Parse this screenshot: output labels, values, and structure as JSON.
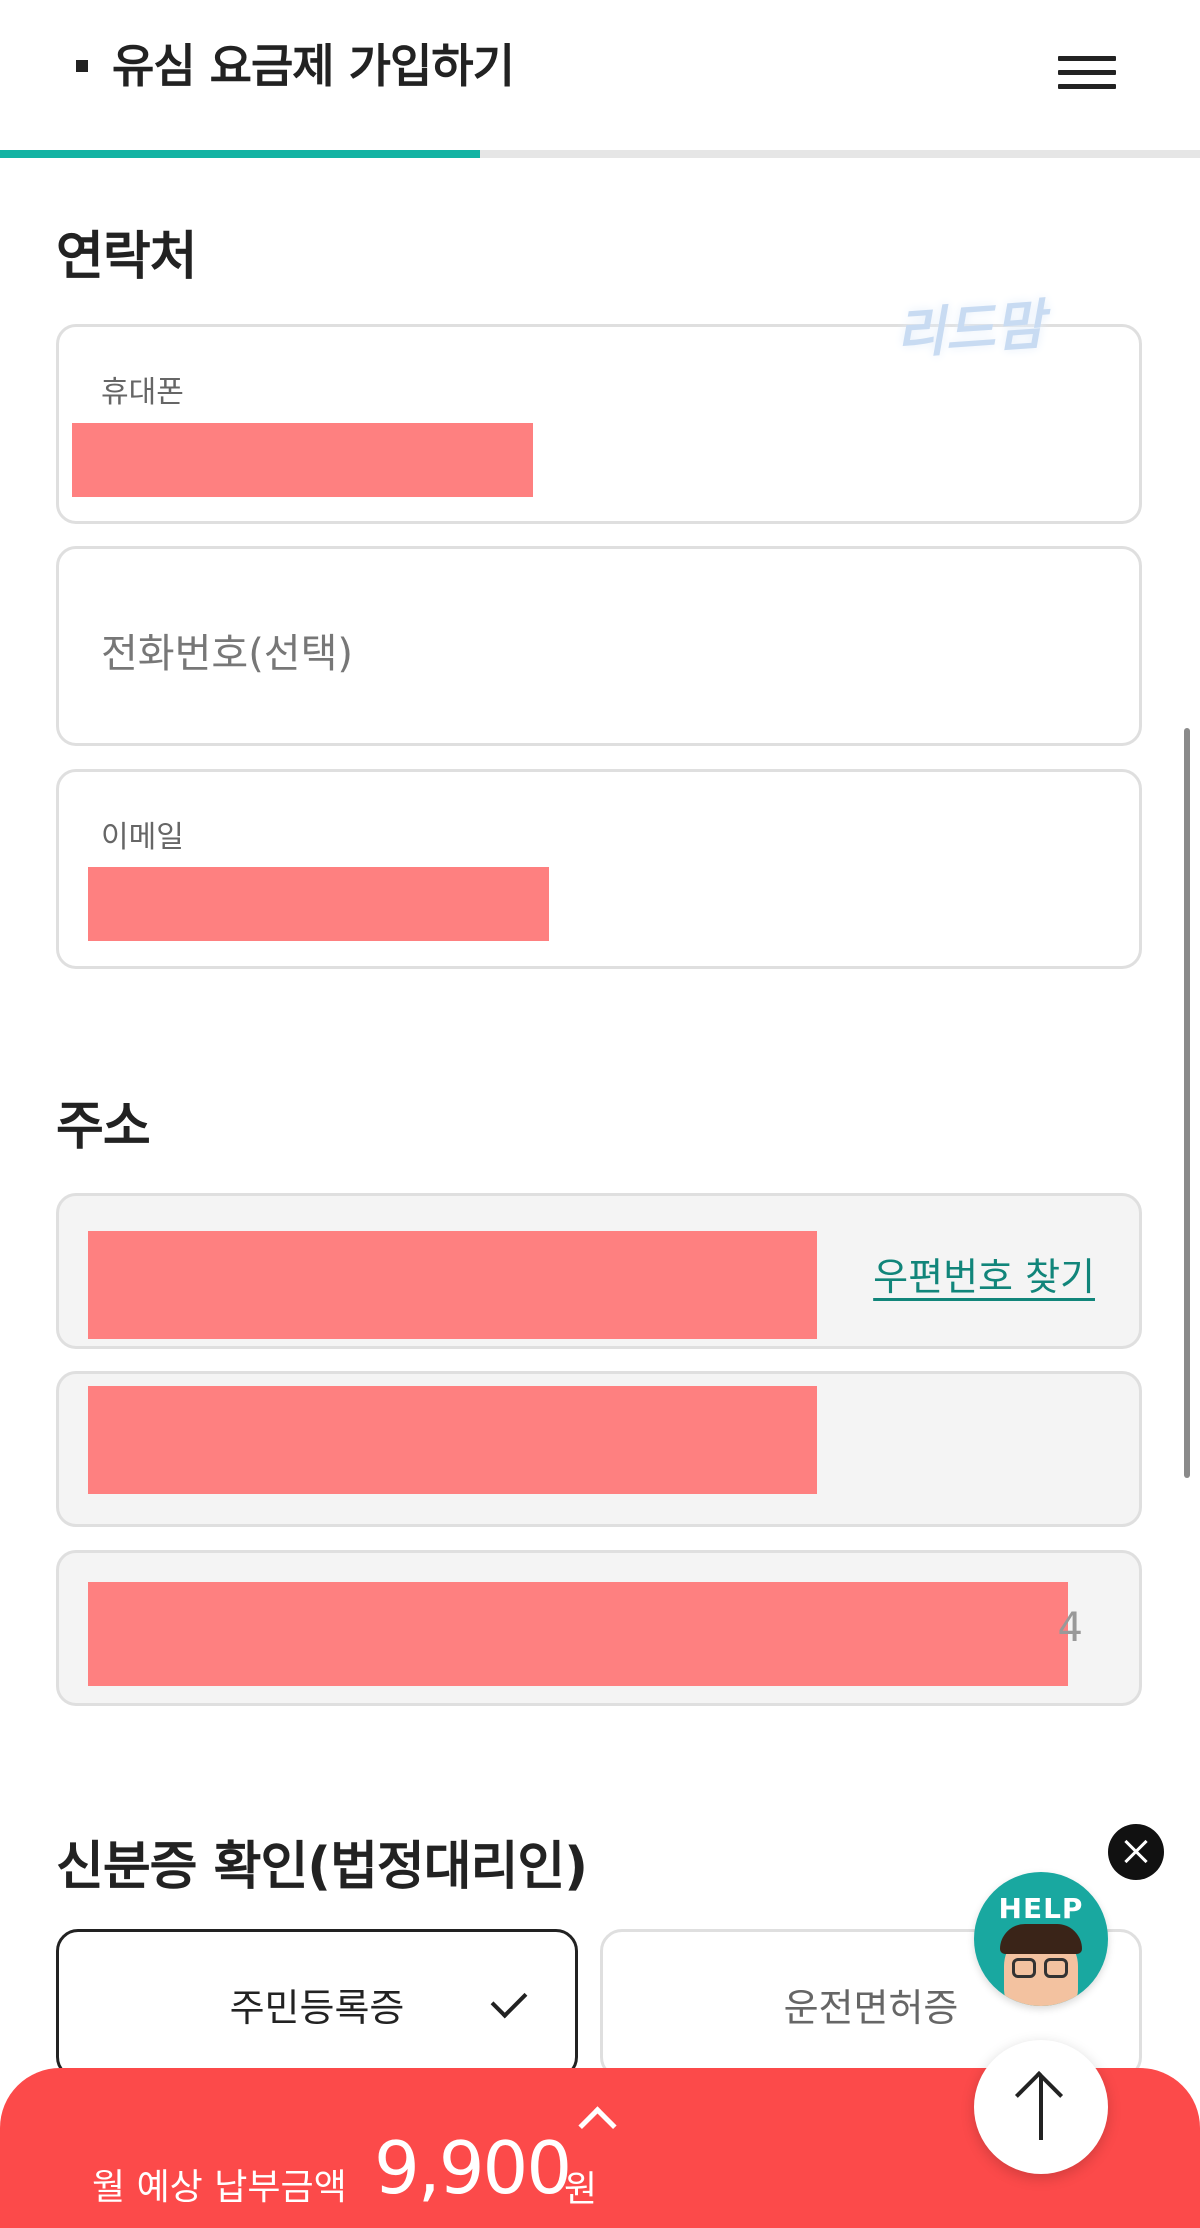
{
  "header": {
    "title": "유심 요금제 가입하기",
    "progress_percent": 40
  },
  "watermark": "리드맘",
  "contact": {
    "section_title": "연락처",
    "mobile_label": "휴대폰",
    "phone_placeholder": "전화번호(선택)",
    "email_label": "이메일"
  },
  "address": {
    "section_title": "주소",
    "zip_search_label": "우편번호 찾기",
    "detail_tail": "4"
  },
  "id_check": {
    "section_title": "신분증 확인(법정대리인)",
    "options": [
      "주민등록증",
      "운전면허증"
    ],
    "selected_index": 0
  },
  "help": {
    "label": "HELP"
  },
  "payment": {
    "label": "월 예상 납부금액",
    "amount": "9,900",
    "unit": "원"
  },
  "colors": {
    "accent": "#13b3a3",
    "brand_red": "#fc4a4a",
    "link": "#11857a",
    "redaction": "#fe8080"
  }
}
